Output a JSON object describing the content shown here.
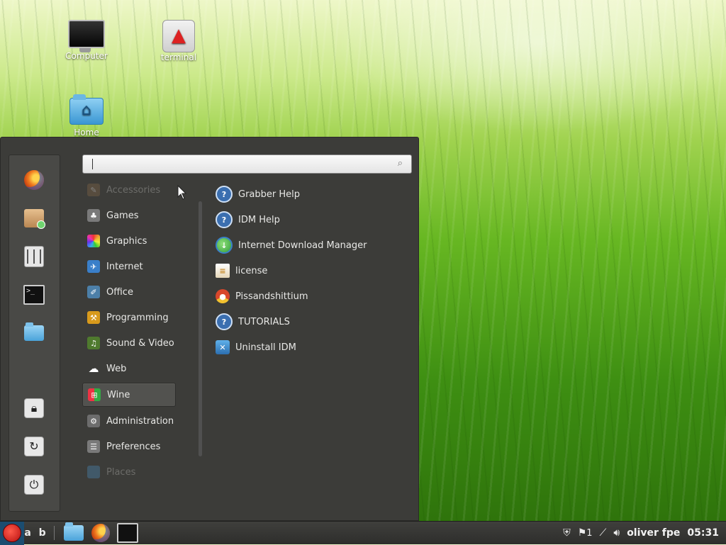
{
  "desktop": {
    "icons": [
      {
        "label": "Computer",
        "icon": "monitor-icon"
      },
      {
        "label": "terminal",
        "icon": "rocket-icon"
      },
      {
        "label": "Home",
        "icon": "home-folder-icon"
      }
    ]
  },
  "menu": {
    "search": {
      "placeholder": "",
      "value": ""
    },
    "favorites": [
      "firefox-icon",
      "package-icon",
      "mixer-icon",
      "terminal-icon",
      "folder-icon"
    ],
    "session": [
      "lock-screen-icon",
      "logout-icon",
      "shutdown-icon"
    ],
    "categories": [
      {
        "label": "Accessories",
        "state": "dim",
        "color": "#8a6a4a"
      },
      {
        "label": "Games",
        "state": "normal",
        "color": "#7a7a7a"
      },
      {
        "label": "Graphics",
        "state": "normal",
        "color": "#d23b8a"
      },
      {
        "label": "Internet",
        "state": "normal",
        "color": "#3a7fc9"
      },
      {
        "label": "Office",
        "state": "normal",
        "color": "#4c7fa8"
      },
      {
        "label": "Programming",
        "state": "normal",
        "color": "#d89a1c"
      },
      {
        "label": "Sound & Video",
        "state": "normal",
        "color": "#4f7a2e"
      },
      {
        "label": "Web",
        "state": "normal",
        "color": "#3c3c39"
      },
      {
        "label": "Wine",
        "state": "active",
        "color": "#c8402d"
      },
      {
        "label": "Administration",
        "state": "normal",
        "color": "#6d6d6d"
      },
      {
        "label": "Preferences",
        "state": "normal",
        "color": "#7a7a7a"
      },
      {
        "label": "Places",
        "state": "dim",
        "color": "#4a90c2"
      }
    ],
    "apps": [
      {
        "label": "Grabber Help",
        "icon": "help-icon",
        "color": "#3b6fb0"
      },
      {
        "label": "IDM Help",
        "icon": "help-icon",
        "color": "#3b6fb0"
      },
      {
        "label": "Internet Download Manager",
        "icon": "idm-globe-icon",
        "color": "#2f9b3a"
      },
      {
        "label": "license",
        "icon": "document-icon",
        "color": "#c78a2a"
      },
      {
        "label": "Pissandshittium",
        "icon": "chromium-icon",
        "color": "#d9472b"
      },
      {
        "label": "TUTORIALS",
        "icon": "help-icon",
        "color": "#3b6fb0"
      },
      {
        "label": "Uninstall IDM",
        "icon": "uninstall-icon",
        "color": "#3a7fc9"
      }
    ]
  },
  "panel": {
    "ab_label": "a b",
    "tray_count": "1",
    "user_label": "oliver fpe",
    "clock": "05:31"
  }
}
